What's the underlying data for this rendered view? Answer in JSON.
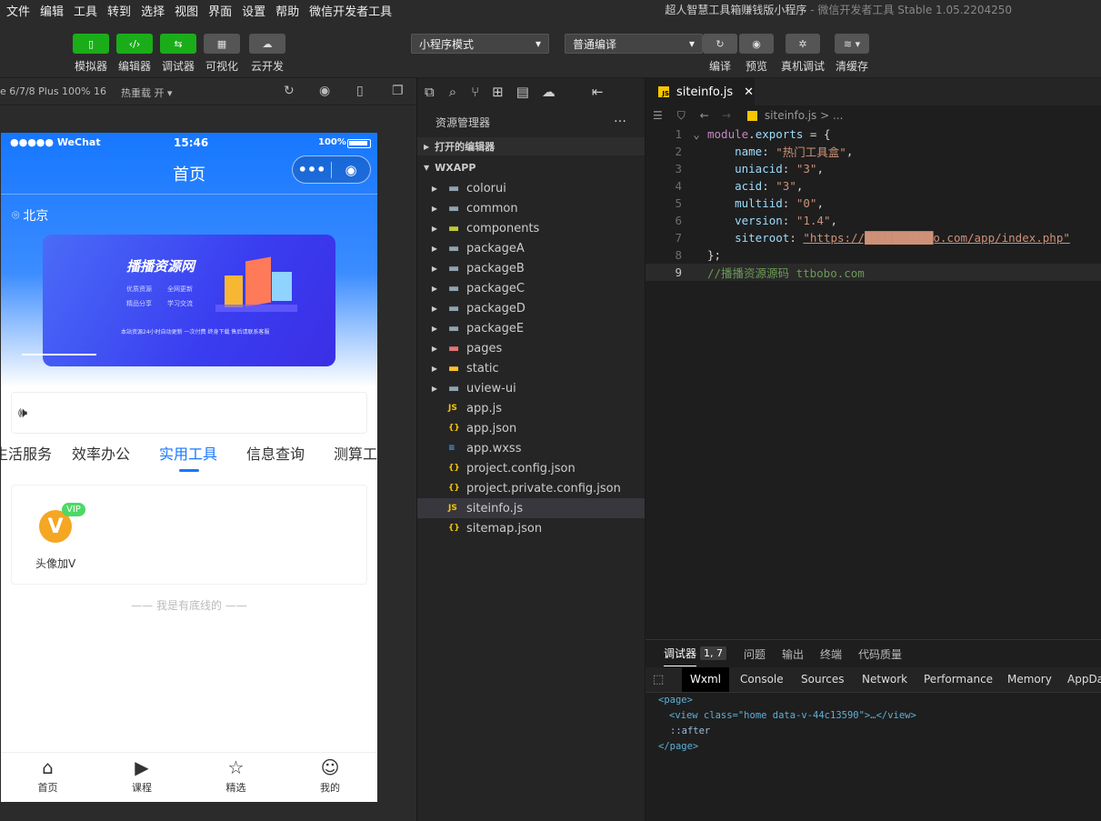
{
  "menubar": {
    "items": [
      "文件",
      "编辑",
      "工具",
      "转到",
      "选择",
      "视图",
      "界面",
      "设置",
      "帮助",
      "微信开发者工具"
    ],
    "title": "超人智慧工具箱赚钱版小程序",
    "title_suffix": " - 微信开发者工具 Stable 1.05.2204250"
  },
  "toolbar": {
    "left_buttons": [
      {
        "label": "模拟器",
        "icon": "phone-icon"
      },
      {
        "label": "编辑器",
        "icon": "code-icon"
      },
      {
        "label": "调试器",
        "icon": "debug-icon"
      },
      {
        "label": "可视化",
        "icon": "layout-icon"
      },
      {
        "label": "云开发",
        "icon": "cloud-icon"
      }
    ],
    "mode_select": "小程序模式",
    "compile_select": "普通编译",
    "right_buttons": [
      {
        "label": "编译",
        "icon": "refresh-icon"
      },
      {
        "label": "预览",
        "icon": "eye-icon"
      },
      {
        "label": "真机调试",
        "icon": "bug-icon"
      },
      {
        "label": "清缓存",
        "icon": "layers-icon"
      }
    ]
  },
  "simulator": {
    "device": "e 6/7/8 Plus 100% 16",
    "hot_reload": "热重载 开",
    "status_left": "●●●●● WeChat",
    "status_time": "15:46",
    "status_battery": "100%",
    "nav_title": "首页",
    "location": "北京",
    "banner_title": "播播资源网",
    "banner_tags": [
      "优质资源",
      "全网更新",
      "精品分享",
      "学习交流"
    ],
    "banner_footer": "本站资源24小时自动更新 一次付费 终身下载 售后请联系客服",
    "tabs": [
      "生活服务",
      "效率办公",
      "实用工具",
      "信息查询",
      "测算工"
    ],
    "active_tab": 2,
    "tool_item": {
      "label": "头像加V",
      "badge": "VIP",
      "icon_letter": "V"
    },
    "footer_text": "—— 我是有底线的 ——",
    "bottom_nav": [
      {
        "label": "首页",
        "icon": "home-icon"
      },
      {
        "label": "课程",
        "icon": "video-icon"
      },
      {
        "label": "精选",
        "icon": "star-icon"
      },
      {
        "label": "我的",
        "icon": "smile-icon"
      }
    ]
  },
  "explorer": {
    "title": "资源管理器",
    "open_editors": "打开的编辑器",
    "project": "WXAPP",
    "items": [
      {
        "name": "colorui",
        "type": "folder"
      },
      {
        "name": "common",
        "type": "folder"
      },
      {
        "name": "components",
        "type": "folder-special"
      },
      {
        "name": "packageA",
        "type": "folder"
      },
      {
        "name": "packageB",
        "type": "folder"
      },
      {
        "name": "packageC",
        "type": "folder"
      },
      {
        "name": "packageD",
        "type": "folder"
      },
      {
        "name": "packageE",
        "type": "folder"
      },
      {
        "name": "pages",
        "type": "folder-red"
      },
      {
        "name": "static",
        "type": "folder-yellow"
      },
      {
        "name": "uview-ui",
        "type": "folder"
      },
      {
        "name": "app.js",
        "type": "js"
      },
      {
        "name": "app.json",
        "type": "json"
      },
      {
        "name": "app.wxss",
        "type": "wxss"
      },
      {
        "name": "project.config.json",
        "type": "json"
      },
      {
        "name": "project.private.config.json",
        "type": "json"
      },
      {
        "name": "siteinfo.js",
        "type": "js"
      },
      {
        "name": "sitemap.json",
        "type": "json"
      }
    ],
    "selected": "siteinfo.js"
  },
  "editor": {
    "tab": "siteinfo.js",
    "breadcrumb": "siteinfo.js > ...",
    "lines": [
      {
        "n": "1",
        "parts": [
          [
            "m",
            "module"
          ],
          [
            "p",
            "."
          ],
          [
            "k",
            "exports"
          ],
          [
            "p",
            " = {"
          ]
        ]
      },
      {
        "n": "2",
        "parts": [
          [
            "k",
            "    name"
          ],
          [
            "p",
            ": "
          ],
          [
            "s",
            "\"热门工具盒\""
          ],
          [
            "p",
            ","
          ]
        ]
      },
      {
        "n": "3",
        "parts": [
          [
            "k",
            "    uniacid"
          ],
          [
            "p",
            ": "
          ],
          [
            "s",
            "\"3\""
          ],
          [
            "p",
            ","
          ]
        ]
      },
      {
        "n": "4",
        "parts": [
          [
            "k",
            "    acid"
          ],
          [
            "p",
            ": "
          ],
          [
            "s",
            "\"3\""
          ],
          [
            "p",
            ","
          ]
        ]
      },
      {
        "n": "5",
        "parts": [
          [
            "k",
            "    multiid"
          ],
          [
            "p",
            ": "
          ],
          [
            "s",
            "\"0\""
          ],
          [
            "p",
            ","
          ]
        ]
      },
      {
        "n": "6",
        "parts": [
          [
            "k",
            "    version"
          ],
          [
            "p",
            ": "
          ],
          [
            "s",
            "\"1.4\""
          ],
          [
            "p",
            ","
          ]
        ]
      },
      {
        "n": "7",
        "parts": [
          [
            "k",
            "    siteroot"
          ],
          [
            "p",
            ": "
          ],
          [
            "s",
            "\"https://██████████o.com/app/index.php\""
          ]
        ]
      },
      {
        "n": "8",
        "parts": [
          [
            "p",
            "};"
          ]
        ]
      },
      {
        "n": "9",
        "parts": [
          [
            "c",
            "//播播资源源码 ttbobo.com"
          ]
        ]
      }
    ]
  },
  "debugger": {
    "tabs": [
      "调试器",
      "问题",
      "输出",
      "终端",
      "代码质量"
    ],
    "badge": "1, 7",
    "devtabs": [
      "Wxml",
      "Console",
      "Sources",
      "Network",
      "Performance",
      "Memory",
      "AppDa"
    ],
    "active_devtab": "Wxml",
    "wxml": [
      "<page>",
      "<view class=\"home data-v-44c13590\">…</view>",
      "::after",
      "</page>"
    ]
  },
  "colors": {
    "accent": "#1aad19",
    "brand_blue": "#1677ff"
  }
}
